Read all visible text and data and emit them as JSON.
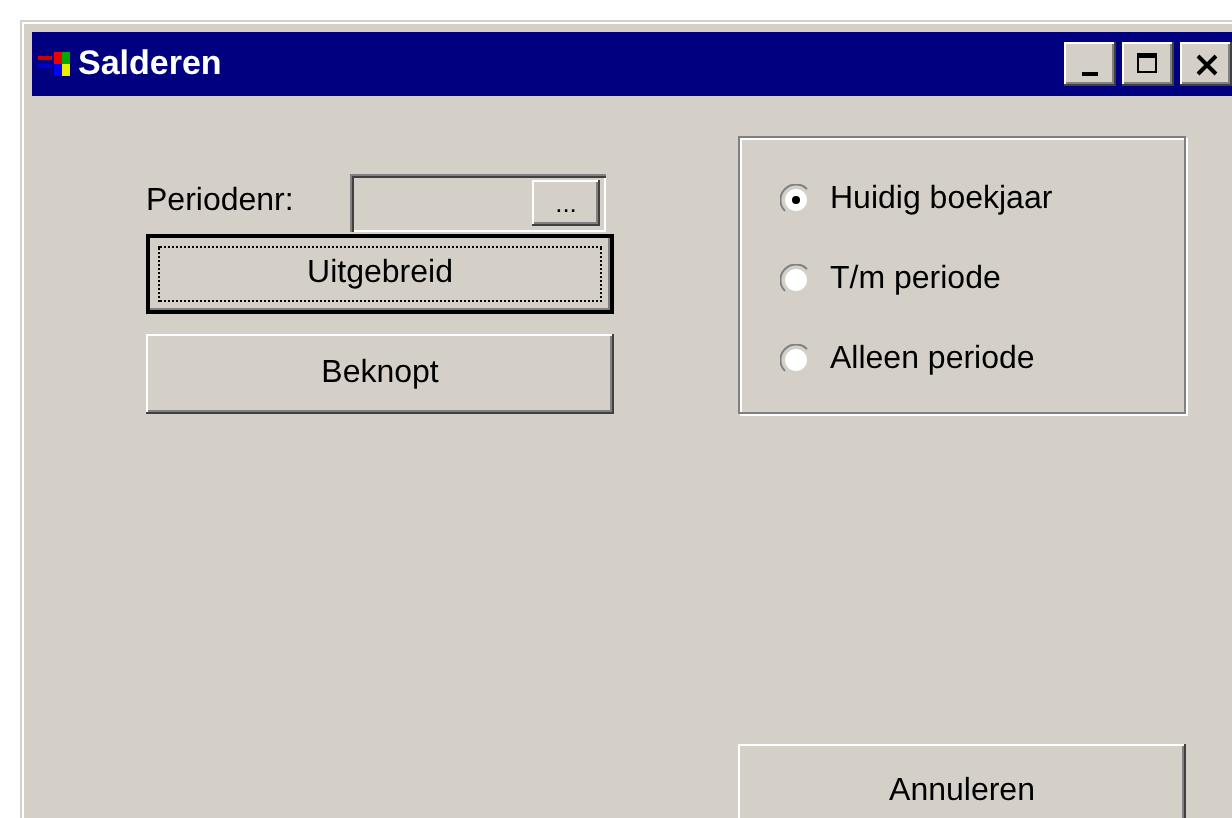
{
  "window": {
    "title": "Salderen"
  },
  "period_field": {
    "label": "Periodenr:",
    "browse_button": "..."
  },
  "report_buttons": [
    {
      "label": "Uitgebreid",
      "focused": true
    },
    {
      "label": "Beknopt",
      "focused": false
    }
  ],
  "scope_options": [
    {
      "label": "Huidig boekjaar",
      "selected": true
    },
    {
      "label": "T/m periode",
      "selected": false
    },
    {
      "label": "Alleen periode",
      "selected": false
    }
  ],
  "cancel_button": {
    "label": "Annuleren"
  }
}
